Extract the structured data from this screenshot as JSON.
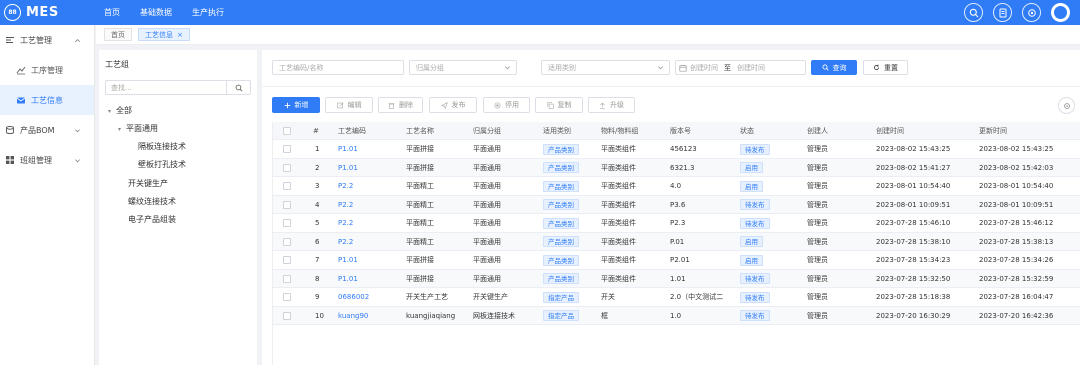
{
  "header": {
    "logo_glyph": "88",
    "app_name": "MES",
    "nav": [
      "首页",
      "基础数据",
      "生产执行"
    ],
    "icons": [
      "search-icon",
      "document-icon",
      "settings-icon",
      "user-avatar"
    ]
  },
  "sidebar": {
    "groups": [
      {
        "label": "工艺管理",
        "icon": "process-icon",
        "expanded": true,
        "children": [
          {
            "label": "工序管理",
            "icon": "chart-icon",
            "active": false
          },
          {
            "label": "工艺信息",
            "icon": "mail-icon",
            "active": true
          }
        ]
      },
      {
        "label": "产品BOM",
        "icon": "database-icon",
        "expanded": false
      },
      {
        "label": "班组管理",
        "icon": "grid-icon",
        "expanded": false
      }
    ]
  },
  "tabs": [
    {
      "label": "首页",
      "active": false
    },
    {
      "label": "工艺信息",
      "active": true,
      "close": "×"
    }
  ],
  "tree": {
    "title": "工艺组",
    "search_placeholder": "查找...",
    "nodes": [
      {
        "label": "全部",
        "arrow": "▾"
      },
      {
        "label": "平面通用",
        "arrow": "▾"
      },
      {
        "label": "隔板连接技术"
      },
      {
        "label": "壁板打孔技术"
      },
      {
        "label": "开关键生产"
      },
      {
        "label": "螺纹连接技术"
      },
      {
        "label": "电子产品组装"
      }
    ]
  },
  "filters": {
    "code_placeholder": "工艺编码/名称",
    "group_placeholder": "归属分组",
    "category_placeholder": "适用类别",
    "date_start_placeholder": "创建时间",
    "date_sep": "至",
    "date_end_placeholder": "创建时间",
    "query_label": "查询",
    "reset_label": "重置"
  },
  "toolbar": {
    "add": "新增",
    "edit": "编辑",
    "delete": "删除",
    "publish": "发布",
    "disable": "停用",
    "copy": "复制",
    "upgrade": "升级"
  },
  "table": {
    "columns": [
      "#",
      "工艺编码",
      "工艺名称",
      "归属分组",
      "适用类别",
      "物料/物料组",
      "版本号",
      "状态",
      "创建人",
      "创建时间",
      "更新时间"
    ],
    "rows": [
      {
        "no": "1",
        "code": "P1.01",
        "name": "平面拼接",
        "group": "平面通用",
        "category": "产品类别",
        "material": "平面类组件",
        "version": "456123",
        "status": "待发布",
        "creator": "管理员",
        "created": "2023-08-02 15:43:25",
        "updated": "2023-08-02 15:43:25"
      },
      {
        "no": "2",
        "code": "P1.01",
        "name": "平面拼接",
        "group": "平面通用",
        "category": "产品类别",
        "material": "平面类组件",
        "version": "6321.3",
        "status": "启用",
        "creator": "管理员",
        "created": "2023-08-02 15:41:27",
        "updated": "2023-08-02 15:42:03"
      },
      {
        "no": "3",
        "code": "P2.2",
        "name": "平面精工",
        "group": "平面通用",
        "category": "产品类别",
        "material": "平面类组件",
        "version": "4.0",
        "status": "启用",
        "creator": "管理员",
        "created": "2023-08-01 10:54:40",
        "updated": "2023-08-01 10:54:40"
      },
      {
        "no": "4",
        "code": "P2.2",
        "name": "平面精工",
        "group": "平面通用",
        "category": "产品类别",
        "material": "平面类组件",
        "version": "P3.6",
        "status": "待发布",
        "creator": "管理员",
        "created": "2023-08-01 10:09:51",
        "updated": "2023-08-01 10:09:51"
      },
      {
        "no": "5",
        "code": "P2.2",
        "name": "平面精工",
        "group": "平面通用",
        "category": "产品类别",
        "material": "平面类组件",
        "version": "P2.3",
        "status": "待发布",
        "creator": "管理员",
        "created": "2023-07-28 15:46:10",
        "updated": "2023-07-28 15:46:12"
      },
      {
        "no": "6",
        "code": "P2.2",
        "name": "平面精工",
        "group": "平面通用",
        "category": "产品类别",
        "material": "平面类组件",
        "version": "P.01",
        "status": "启用",
        "creator": "管理员",
        "created": "2023-07-28 15:38:10",
        "updated": "2023-07-28 15:38:13"
      },
      {
        "no": "7",
        "code": "P1.01",
        "name": "平面拼接",
        "group": "平面通用",
        "category": "产品类别",
        "material": "平面类组件",
        "version": "P2.01",
        "status": "启用",
        "creator": "管理员",
        "created": "2023-07-28 15:34:23",
        "updated": "2023-07-28 15:34:26"
      },
      {
        "no": "8",
        "code": "P1.01",
        "name": "平面拼接",
        "group": "平面通用",
        "category": "产品类别",
        "material": "平面类组件",
        "version": "1.01",
        "status": "待发布",
        "creator": "管理员",
        "created": "2023-07-28 15:32:50",
        "updated": "2023-07-28 15:32:59"
      },
      {
        "no": "9",
        "code": "0686002",
        "name": "开关生产工艺",
        "group": "开关键生产",
        "category": "指定产品",
        "material": "开关",
        "version": "2.0（中文测试二",
        "status": "待发布",
        "creator": "管理员",
        "created": "2023-07-28 15:18:38",
        "updated": "2023-07-28 16:04:47"
      },
      {
        "no": "10",
        "code": "kuang90",
        "name": "kuangjiaqiang",
        "group": "网板连接技术",
        "category": "指定产品",
        "material": "框",
        "version": "1.0",
        "status": "待发布",
        "creator": "管理员",
        "created": "2023-07-20 16:30:29",
        "updated": "2023-07-20 16:42:36"
      }
    ]
  },
  "colors": {
    "primary": "#2f7cf6",
    "tag_bg": "#e6f0fe"
  }
}
